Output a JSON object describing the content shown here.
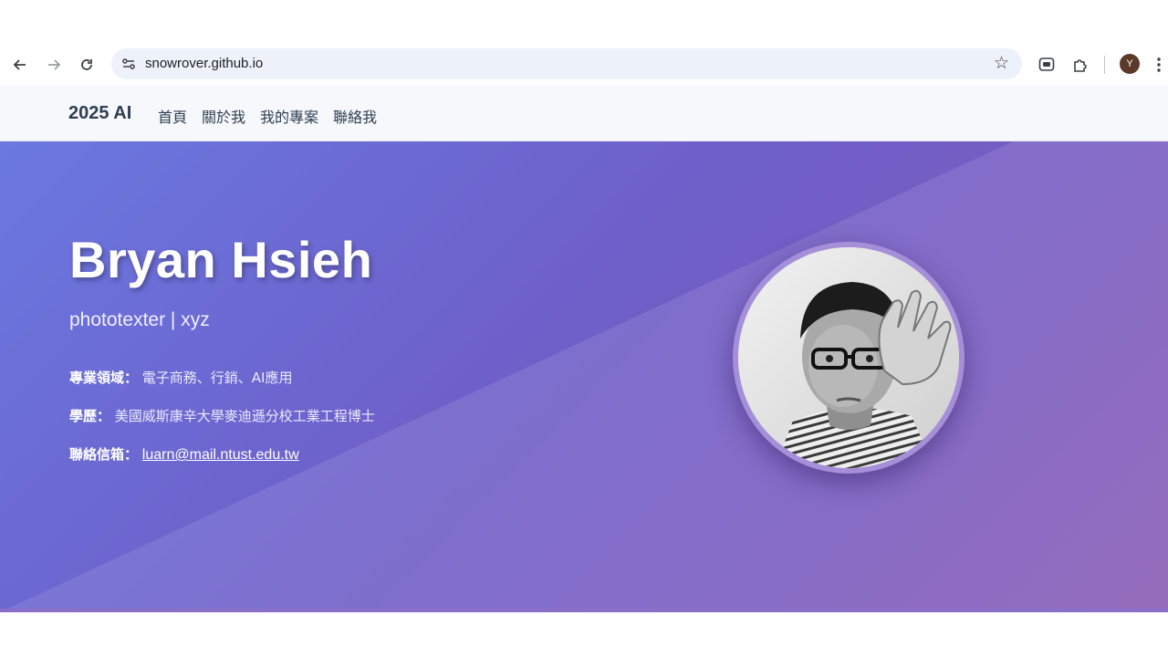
{
  "browser": {
    "url": "snowrover.github.io",
    "avatar_letter": "Y",
    "icons": {
      "back": "arrow-left-icon",
      "forward": "arrow-right-icon",
      "reload": "reload-icon",
      "site_info": "tune-icon",
      "bookmark": "star-icon",
      "extension_line": "line-app-icon",
      "extensions": "puzzle-icon",
      "menu": "kebab-menu-icon"
    }
  },
  "navbar": {
    "brand": "2025 AI",
    "links": [
      "首頁",
      "關於我",
      "我的專案",
      "聯絡我"
    ]
  },
  "hero": {
    "name": "Bryan Hsieh",
    "subtitle": "phototexter | xyz",
    "expertise_label": "專業領域：",
    "expertise_value": "電子商務、行銷、AI應用",
    "education_label": "學歷：",
    "education_value": "美國威斯康辛大學麥迪遜分校工業工程博士",
    "contact_label": "聯絡信箱：",
    "contact_email": "luarn@mail.ntust.edu.tw"
  },
  "colors": {
    "hero_start": "#6a78e0",
    "hero_end": "#8a5db5",
    "brand_text": "#2c3e50"
  }
}
